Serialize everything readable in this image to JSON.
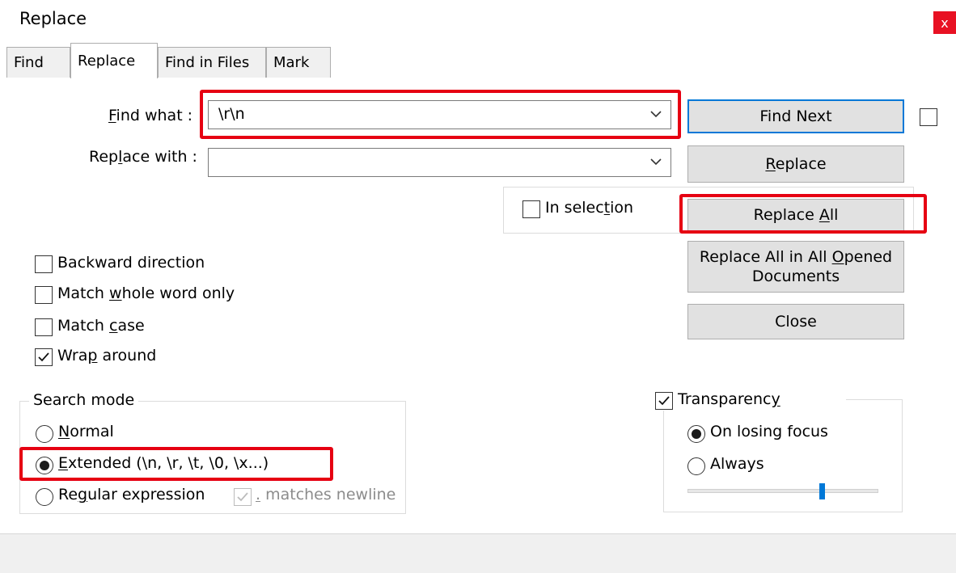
{
  "window": {
    "title": "Replace",
    "close_glyph": "x"
  },
  "tabs": [
    {
      "label": "Find",
      "active": false
    },
    {
      "label": "Replace",
      "active": true
    },
    {
      "label": "Find in Files",
      "active": false
    },
    {
      "label": "Mark",
      "active": false
    }
  ],
  "find": {
    "label_pre": "",
    "label_key": "F",
    "label_post": "ind what :",
    "value": "\\r\\n"
  },
  "replace": {
    "label_pre": "Rep",
    "label_key": "l",
    "label_post": "ace with :",
    "value": ""
  },
  "buttons": {
    "find_next": "Find Next",
    "replace_pre": "",
    "replace_key": "R",
    "replace_post": "eplace",
    "replace_all_pre": "Replace ",
    "replace_all_key": "A",
    "replace_all_post": "ll",
    "replace_all_opened_line1_pre": "Replace All in All ",
    "replace_all_opened_line1_key": "O",
    "replace_all_opened_line1_post": "pened",
    "replace_all_opened_line2": "Documents",
    "close": "Close"
  },
  "in_selection": {
    "pre": "In selec",
    "key": "t",
    "post": "ion",
    "checked": false
  },
  "options": {
    "backward_direction": {
      "label": "Backward direction",
      "checked": false
    },
    "match_whole_word": {
      "pre": "Match ",
      "key": "w",
      "post": "hole word only",
      "checked": false
    },
    "match_case": {
      "pre": "Match ",
      "key": "c",
      "post": "ase",
      "checked": false
    },
    "wrap_around": {
      "pre": "Wra",
      "key": "p",
      "post": " around",
      "checked": true
    }
  },
  "search_mode": {
    "title": "Search mode",
    "normal": {
      "pre": "",
      "key": "N",
      "post": "ormal",
      "selected": false
    },
    "extended": {
      "pre": "",
      "key": "E",
      "post": "xtended (\\n, \\r, \\t, \\0, \\x...)",
      "selected": true
    },
    "regex": {
      "pre": "Re",
      "key": "g",
      "post": "ular expression",
      "selected": false
    },
    "dot_newline": {
      "key": ".",
      "post": " matches newline",
      "checked": true,
      "enabled": false
    }
  },
  "transparency": {
    "pre": "Transparenc",
    "key": "y",
    "post": "",
    "checked": true,
    "on_losing_focus": {
      "label": "On losing focus",
      "selected": true
    },
    "always": {
      "label": "Always",
      "selected": false
    },
    "slider_value": 0.71
  },
  "colors": {
    "highlight": "#e60012",
    "default_button_border": "#0078d7",
    "close_button": "#e81123"
  }
}
